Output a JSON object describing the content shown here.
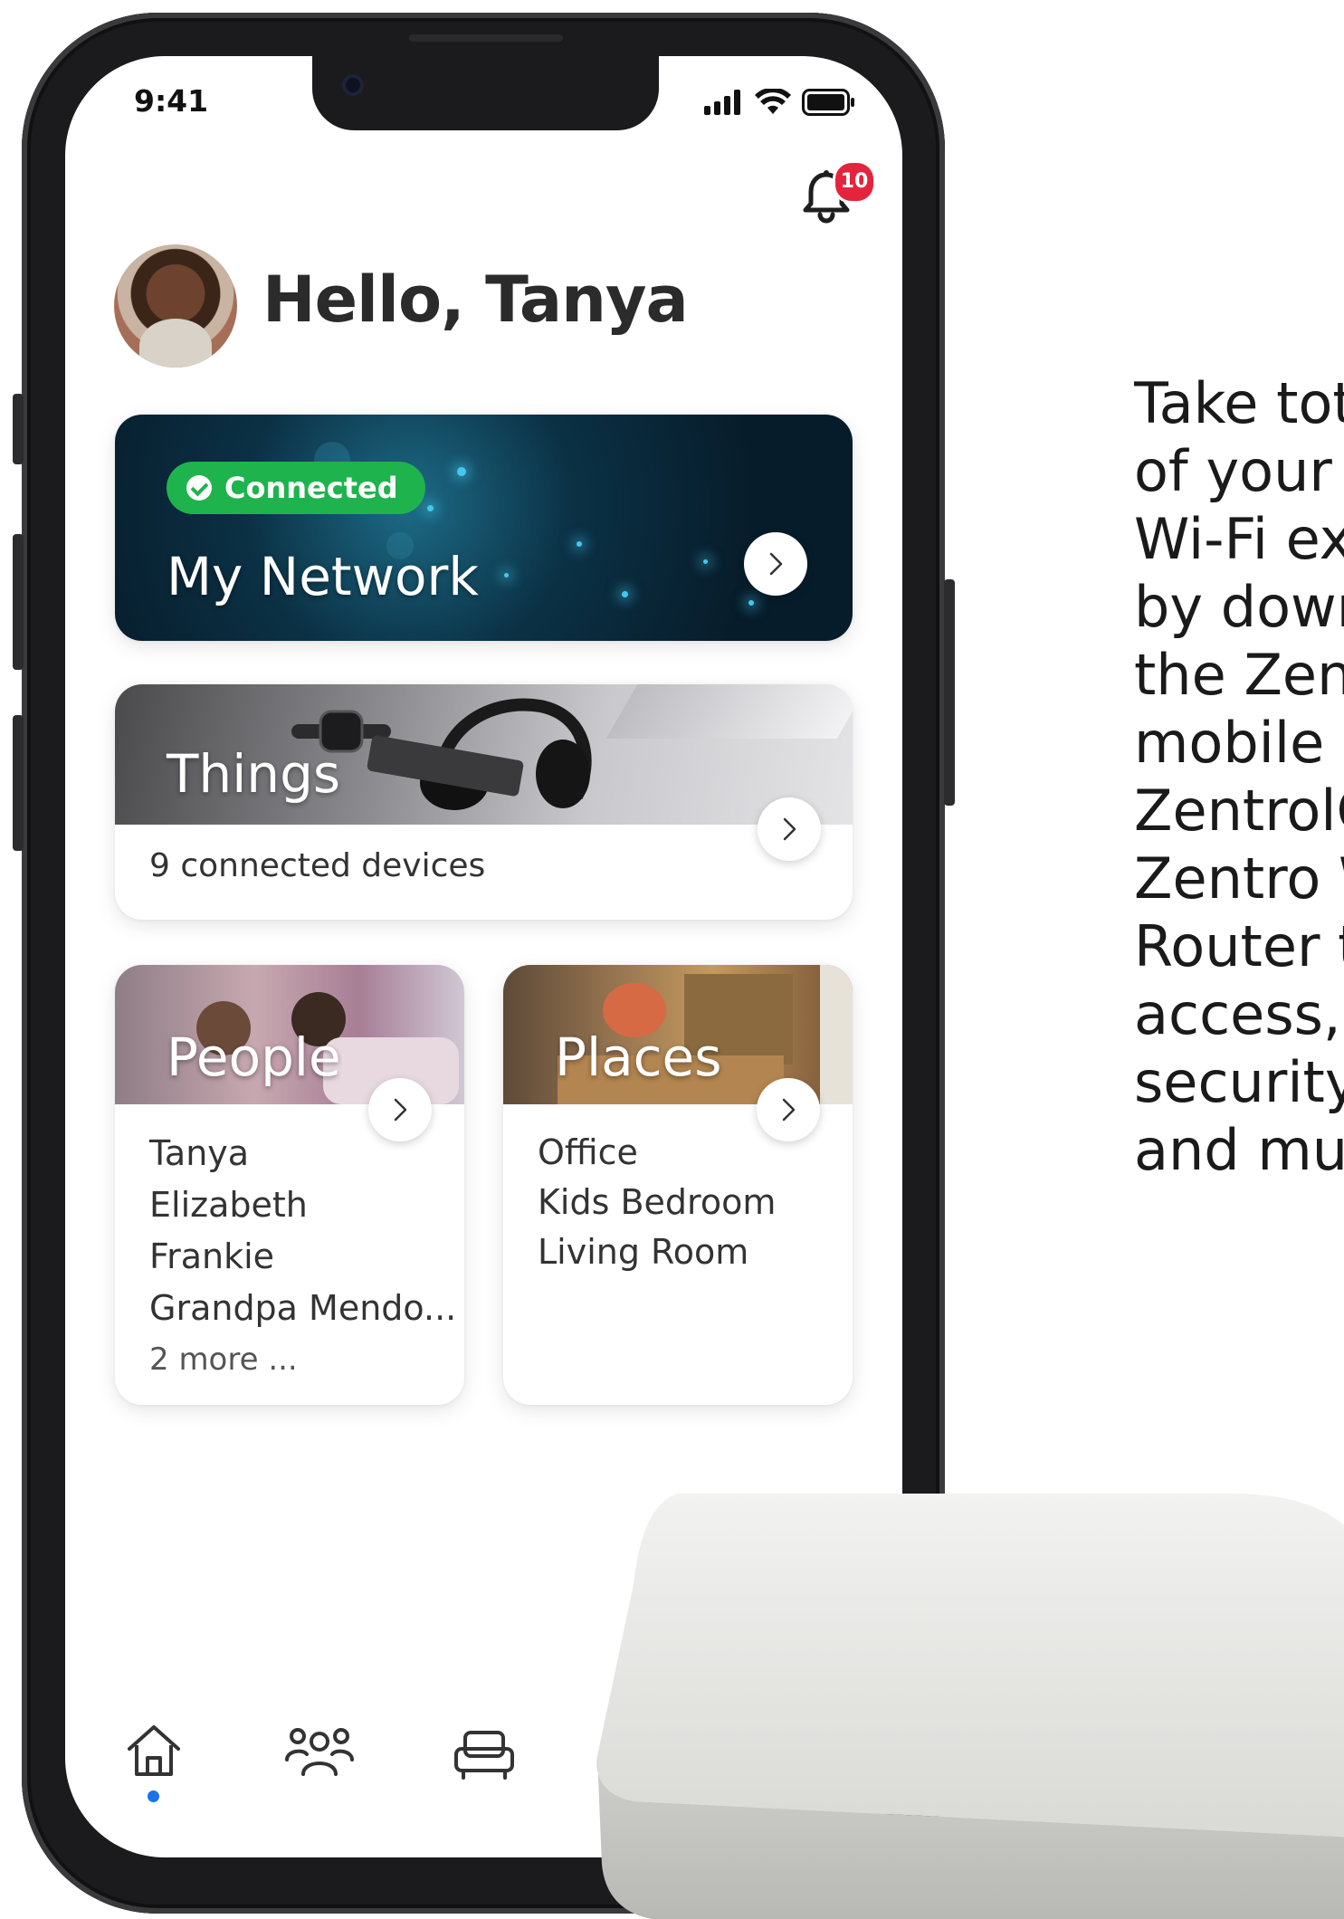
{
  "status_bar": {
    "time": "9:41"
  },
  "notifications": {
    "count": "10"
  },
  "greeting": "Hello, Tanya",
  "network": {
    "status": "Connected",
    "title": "My Network"
  },
  "things": {
    "title": "Things",
    "subtitle": "9 connected devices"
  },
  "people": {
    "title": "People",
    "items": [
      "Tanya",
      "Elizabeth",
      "Frankie",
      "Grandpa Mendo..."
    ],
    "more": "2 more ..."
  },
  "places": {
    "title": "Places",
    "items": [
      "Office",
      "Kids Bedroom",
      "Living Room"
    ]
  },
  "side_text": {
    "lines": [
      "Take tota",
      "of your i",
      "Wi-Fi ex",
      "by down",
      "the Zent",
      "mobile a",
      "ZentrolQ",
      "Zentro W",
      "Router t",
      "access,",
      "security",
      "and muc"
    ]
  },
  "colors": {
    "connected_green": "#1fb34e",
    "badge_red": "#e5233c",
    "active_blue": "#1a73e8"
  }
}
